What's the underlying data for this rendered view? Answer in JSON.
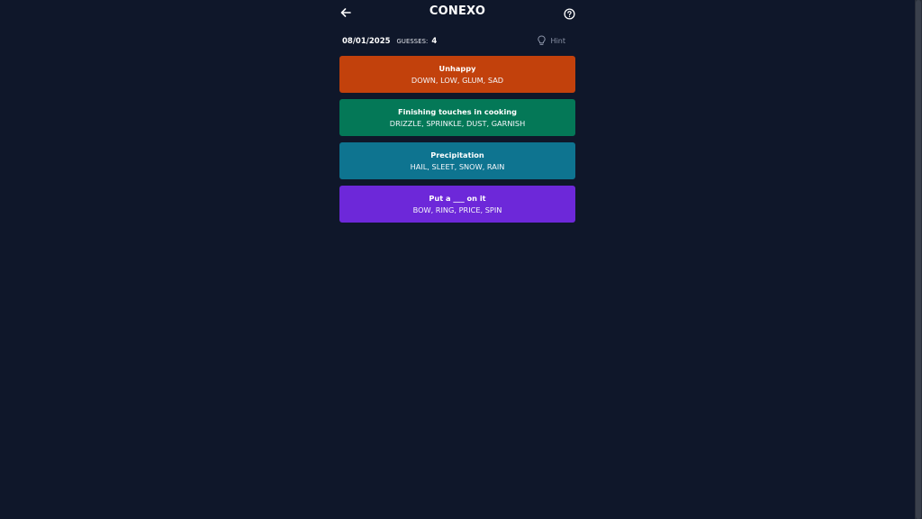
{
  "header": {
    "title": "CONEXO"
  },
  "status": {
    "date": "08/01/2025",
    "guesses_label": "GUESSES:",
    "guesses_value": "4",
    "hint_label": "Hint"
  },
  "groups": [
    {
      "title": "Unhappy",
      "words": "DOWN, LOW, GLUM, SAD",
      "color": "#c2410c"
    },
    {
      "title": "Finishing touches in cooking",
      "words": "DRIZZLE, SPRINKLE, DUST, GARNISH",
      "color": "#047857"
    },
    {
      "title": "Precipitation",
      "words": "HAIL, SLEET, SNOW, RAIN",
      "color": "#0e7490"
    },
    {
      "title": "Put a ___ on it",
      "words": "BOW, RING, PRICE, SPIN",
      "color": "#6d28d9"
    }
  ],
  "colors": {
    "background": "#0f172a",
    "muted": "#8b93a7"
  },
  "icons": {
    "back": "arrow-left-icon",
    "help": "question-circle-icon",
    "hint": "lightbulb-icon"
  }
}
